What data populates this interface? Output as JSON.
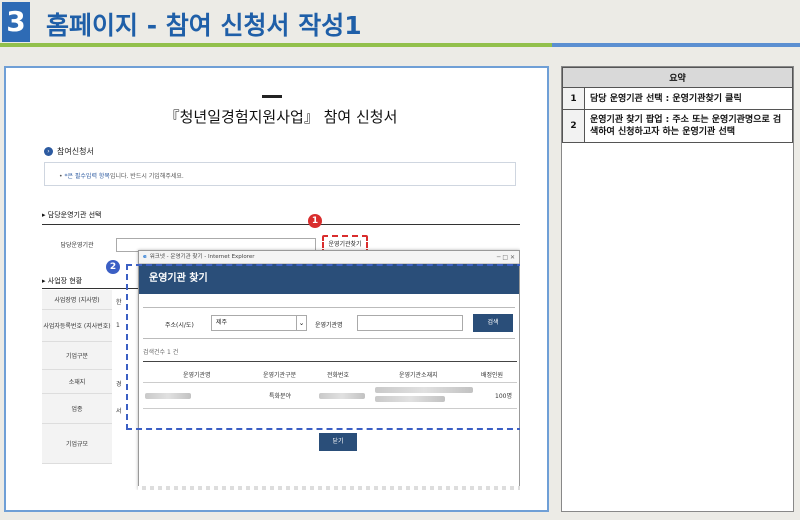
{
  "header": {
    "step_number": "3",
    "title": "홈페이지 - 참여 신청서 작성1"
  },
  "form": {
    "title": "『청년일경험지원사업』 참여 신청서",
    "section_title": "참여신청서",
    "notice_marker": "•",
    "notice_required": "*은 필수입력 항목",
    "notice_rest": "입니다. 반드시 기입해주세요.",
    "org_section_title": "담당운영기관 선택",
    "org_label": "담당운영기관",
    "find_button": "운영기관찾기",
    "workplace_section_title": "사업장 현황",
    "left_rows": [
      "사업장명 (지사명)",
      "사업자등록번호 (지사번호)",
      "기업구분",
      "소재지",
      "업종",
      "기업규모"
    ],
    "left_values": [
      "한",
      "1",
      "",
      "경",
      "서",
      ""
    ]
  },
  "badges": {
    "one": "1",
    "two": "2"
  },
  "popup": {
    "window_title": "워크넷 - 운영기관 찾기 - Internet Explorer",
    "window_controls": "─ □ ✕",
    "heading": "운영기관 찾기",
    "address_label": "주소(시/도)",
    "address_value": "제주",
    "org_name_label": "운영기관명",
    "org_name_placeholder": "",
    "search_button": "검색",
    "result_count": "검색건수 1 건",
    "columns": [
      "운영기관명",
      "운영기관구분",
      "전화번호",
      "운영기관소재지",
      "배정인원"
    ],
    "row": {
      "type": "특화분야",
      "assigned": "100명"
    },
    "close_button": "닫기"
  },
  "summary": {
    "header": "요약",
    "items": [
      {
        "num": "1",
        "text": "담당 운영기관 선택 : 운영기관찾기 클릭"
      },
      {
        "num": "2",
        "text": "운영기관 찾기 팝업 : 주소 또는 운영기관명으로 검색하여 신청하고자 하는 운영기관 선택"
      }
    ]
  },
  "colors": {
    "brand_blue": "#1f5fa8",
    "accent_red": "#d92d2d",
    "popup_navy": "#2a4e79",
    "green_rule": "#92c04c"
  },
  "icons": [
    "chevron-down-icon",
    "ie-icon",
    "section-bullet-icon"
  ]
}
